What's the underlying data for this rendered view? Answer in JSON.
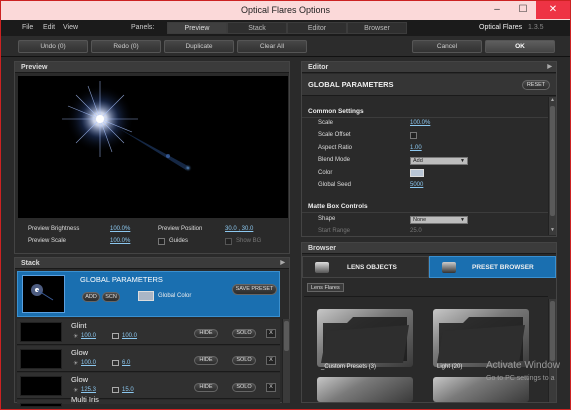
{
  "window": {
    "title": "Optical Flares Options",
    "min": "–",
    "max": "☐",
    "close": "✕"
  },
  "menu": {
    "items": [
      "File",
      "Edit",
      "View"
    ],
    "panels_label": "Panels:",
    "tabs": [
      "Preview",
      "Stack",
      "Editor",
      "Browser"
    ],
    "brand": "Optical Flares",
    "version": "1.3.5"
  },
  "toolbar": {
    "undo": "Undo (0)",
    "redo": "Redo (0)",
    "duplicate": "Duplicate",
    "clear_all": "Clear All",
    "cancel": "Cancel",
    "ok": "OK"
  },
  "preview": {
    "title": "Preview",
    "brightness_label": "Preview Brightness",
    "brightness_value": "100.0%",
    "position_label": "Preview Position",
    "position_value": "30.0 , 30.0",
    "scale_label": "Preview Scale",
    "scale_value": "100.0%",
    "guides_label": "Guides",
    "show_bg_label": "Show BG"
  },
  "stack": {
    "title": "Stack",
    "global": {
      "title": "GLOBAL PARAMETERS",
      "add": "ADD",
      "scn": "SCN",
      "color_label": "Global Color",
      "save_preset": "SAVE PRESET"
    },
    "elements": [
      {
        "name": "Glint",
        "brightness": "100.0",
        "scale": "100.0",
        "hide": "HIDE",
        "solo": "SOLO",
        "x": "X"
      },
      {
        "name": "Glow",
        "brightness": "100.0",
        "scale": "6.0",
        "hide": "HIDE",
        "solo": "SOLO",
        "x": "X"
      },
      {
        "name": "Glow",
        "brightness": "125.3",
        "scale": "15.0",
        "hide": "HIDE",
        "solo": "SOLO",
        "x": "X"
      },
      {
        "name": "Multi Iris"
      }
    ]
  },
  "editor": {
    "title": "Editor",
    "header": "GLOBAL PARAMETERS",
    "reset": "RESET",
    "common_settings": "Common Settings",
    "rows": [
      {
        "label": "Scale",
        "value": "100.0%"
      },
      {
        "label": "Scale Offset",
        "value": ""
      },
      {
        "label": "Aspect Ratio",
        "value": "1.00"
      },
      {
        "label": "Blend Mode",
        "value": "Add"
      },
      {
        "label": "Color",
        "value": ""
      },
      {
        "label": "Global Seed",
        "value": "5000"
      }
    ],
    "matte_box": "Matte Box Controls",
    "shape_label": "Shape",
    "shape_value": "None",
    "start_range_label": "Start Range",
    "start_range_value": "25.0"
  },
  "browser": {
    "title": "Browser",
    "tab_lens": "LENS OBJECTS",
    "tab_preset": "PRESET BROWSER",
    "path": "Lens Flares",
    "folders": [
      "_Custom Presets (3)",
      "Light (20)"
    ]
  },
  "watermark": {
    "line1": "Activate Window",
    "line2": "Go to PC settings to a"
  },
  "colors": {
    "accent_blue": "#1a6fb0",
    "link": "#8cc8f0"
  }
}
